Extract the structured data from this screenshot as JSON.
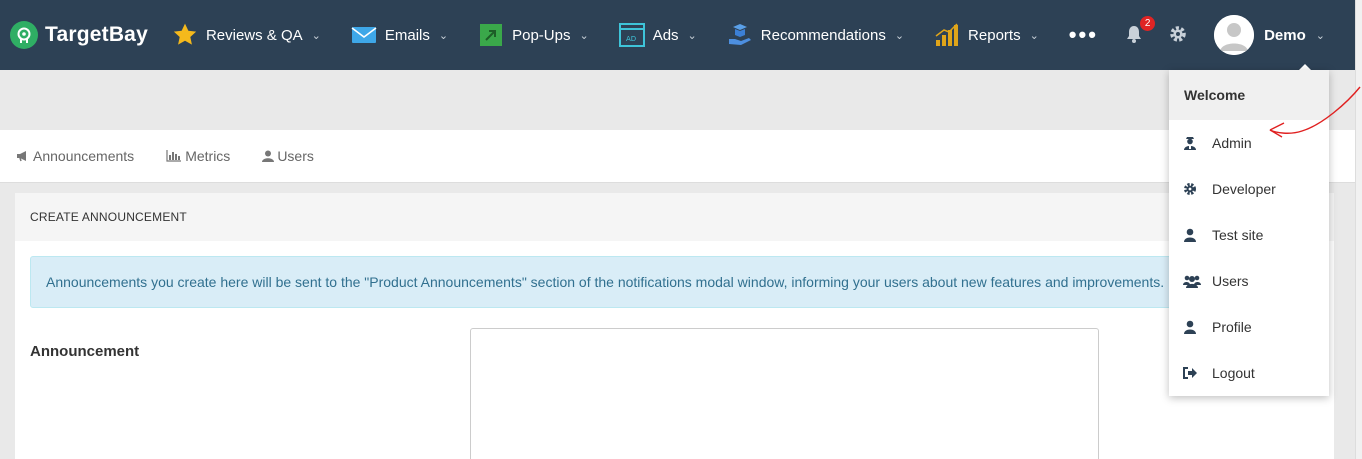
{
  "brand": {
    "name": "TargetBay"
  },
  "nav": [
    {
      "label": "Reviews & QA",
      "icon": "star-icon"
    },
    {
      "label": "Emails",
      "icon": "envelope-icon"
    },
    {
      "label": "Pop-Ups",
      "icon": "popup-arrow-icon"
    },
    {
      "label": "Ads",
      "icon": "ad-window-icon"
    },
    {
      "label": "Recommendations",
      "icon": "hand-box-icon"
    },
    {
      "label": "Reports",
      "icon": "bar-chart-icon"
    }
  ],
  "more_label": "•••",
  "notifications": {
    "count": "2"
  },
  "user": {
    "name": "Demo"
  },
  "subnav": [
    {
      "label": "Announcements",
      "icon": "megaphone-icon"
    },
    {
      "label": "Metrics",
      "icon": "chart-icon"
    },
    {
      "label": "Users",
      "icon": "user-icon"
    }
  ],
  "panel": {
    "title": "CREATE ANNOUNCEMENT",
    "info": "Announcements you create here will be sent to the \"Product Announcements\" section of the notifications modal window, informing your users about new features and improvements.",
    "field_label": "Announcement",
    "field_value": ""
  },
  "dropdown": {
    "header": "Welcome",
    "items": [
      {
        "label": "Admin",
        "icon": "admin-user-icon"
      },
      {
        "label": "Developer",
        "icon": "gear-icon"
      },
      {
        "label": "Test site",
        "icon": "user-icon"
      },
      {
        "label": "Users",
        "icon": "users-icon"
      },
      {
        "label": "Profile",
        "icon": "user-icon"
      },
      {
        "label": "Logout",
        "icon": "sign-out-icon"
      }
    ]
  },
  "colors": {
    "navbar": "#2d4155",
    "brand_green": "#2fae64",
    "info_bg": "#d9edf7",
    "info_text": "#31708f",
    "badge": "#e02424",
    "annotation": "#e02020"
  }
}
